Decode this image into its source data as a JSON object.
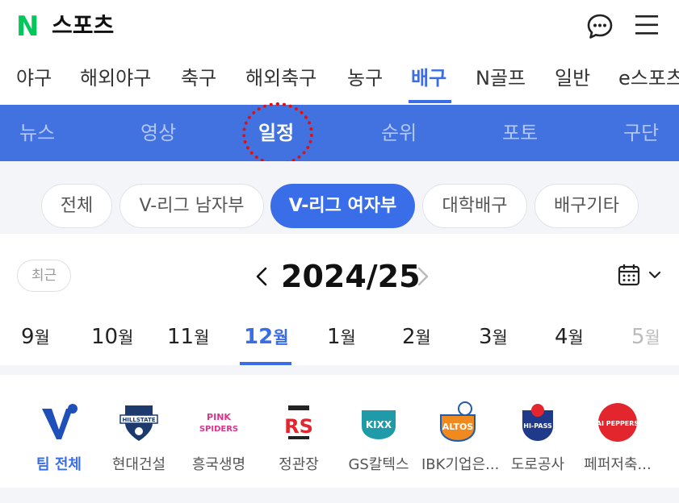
{
  "header": {
    "logo": "N",
    "title": "스포츠",
    "icons": {
      "chat": "chat-bubble-icon",
      "menu": "hamburger-menu-icon"
    }
  },
  "sports_nav": {
    "items": [
      "야구",
      "해외야구",
      "축구",
      "해외축구",
      "농구",
      "배구",
      "N골프",
      "일반",
      "e스포츠"
    ],
    "active": "배구"
  },
  "sub_nav": {
    "items": [
      "뉴스",
      "영상",
      "일정",
      "순위",
      "포토",
      "구단"
    ],
    "active": "일정"
  },
  "filters": {
    "items": [
      "전체",
      "V-리그 남자부",
      "V-리그 여자부",
      "대학배구",
      "배구기타"
    ],
    "active": "V-리그 여자부"
  },
  "season": {
    "recent_label": "최근",
    "label": "2024/25",
    "icons": {
      "prev": "chevron-left-icon",
      "next": "chevron-right-icon",
      "calendar": "calendar-icon",
      "dropdown": "chevron-down-icon"
    }
  },
  "months": {
    "unit": "월",
    "items": [
      "9",
      "10",
      "11",
      "12",
      "1",
      "2",
      "3",
      "4",
      "5"
    ],
    "active": "12",
    "disabled": [
      "5"
    ]
  },
  "teams": {
    "items": [
      {
        "name": "팀 전체",
        "logo_text": "V"
      },
      {
        "name": "현대건설",
        "logo_text": "HILLSTATE"
      },
      {
        "name": "흥국생명",
        "logo_text": "PINK SPIDERS"
      },
      {
        "name": "정관장",
        "logo_text": "RS"
      },
      {
        "name": "GS칼텍스",
        "logo_text": "KIXX"
      },
      {
        "name": "IBK기업은...",
        "logo_text": "ALTOS"
      },
      {
        "name": "도로공사",
        "logo_text": "HI-PASS"
      },
      {
        "name": "페퍼저축...",
        "logo_text": "AI PEPPERS"
      }
    ],
    "active": "팀 전체"
  },
  "colors": {
    "accent": "#3a6ee8",
    "subnav_bg": "#4271e0",
    "brand_green": "#03c75a",
    "annotation_red": "#dd1111"
  }
}
